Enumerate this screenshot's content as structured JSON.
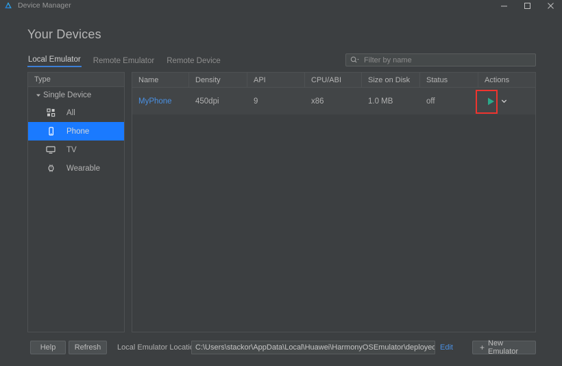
{
  "window": {
    "title": "Device Manager",
    "logo_icon": "harmony-logo-icon",
    "minimize_icon": "minimize-icon",
    "maximize_icon": "maximize-icon",
    "close_icon": "close-icon"
  },
  "page": {
    "heading": "Your Devices"
  },
  "tabs": [
    {
      "label": "Local Emulator",
      "active": true
    },
    {
      "label": "Remote Emulator",
      "active": false
    },
    {
      "label": "Remote Device",
      "active": false
    }
  ],
  "filter": {
    "placeholder": "Filter by name",
    "value": "",
    "icon": "search-icon"
  },
  "sidebar": {
    "header": "Type",
    "group": {
      "label": "Single Device",
      "expanded": true,
      "arrow_icon": "triangle-down-icon"
    },
    "items": [
      {
        "label": "All",
        "icon": "apps-grid-icon",
        "selected": false
      },
      {
        "label": "Phone",
        "icon": "phone-icon",
        "selected": true
      },
      {
        "label": "TV",
        "icon": "tv-icon",
        "selected": false
      },
      {
        "label": "Wearable",
        "icon": "watch-icon",
        "selected": false
      }
    ]
  },
  "table": {
    "columns": [
      "Name",
      "Density",
      "API",
      "CPU/ABI",
      "Size on Disk",
      "Status",
      "Actions"
    ],
    "rows": [
      {
        "name": "MyPhone",
        "density": "450dpi",
        "api": "9",
        "cpu_abi": "x86",
        "size_on_disk": "1.0 MB",
        "status": "off",
        "actions": {
          "play_icon": "play-icon",
          "more_icon": "chevron-down-icon"
        }
      }
    ]
  },
  "annotation": {
    "highlight_target": "play-button",
    "color": "#f0342e"
  },
  "footer": {
    "help_label": "Help",
    "refresh_label": "Refresh",
    "location_label": "Local Emulator Location:",
    "location_value": "C:\\Users\\stackor\\AppData\\Local\\Huawei\\HarmonyOSEmulator\\deployed",
    "edit_label": "Edit",
    "new_emulator_label": "New Emulator",
    "new_emulator_plus": "+"
  },
  "colors": {
    "accent_blue": "#1a7aff",
    "link_blue": "#4a90e2",
    "tab_underline": "#3d7fd6",
    "play_green": "#2aa98a",
    "annotation_red": "#f0342e",
    "window_bg": "#3c3f41",
    "panel_header": "#444749",
    "row_bg": "#424547"
  }
}
